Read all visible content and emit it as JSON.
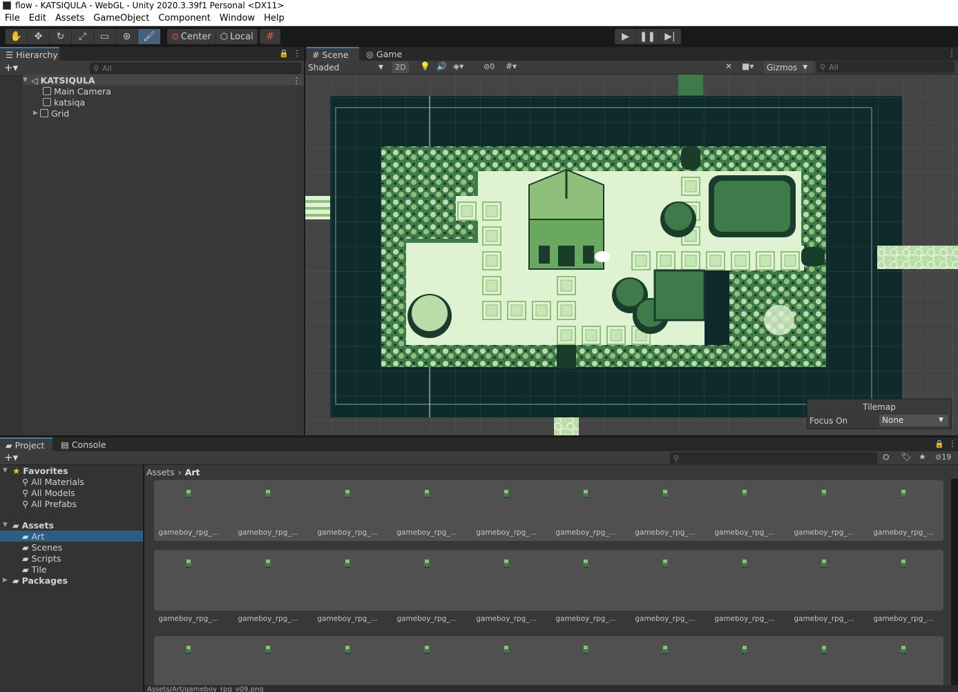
{
  "window": {
    "title": "flow - KATSIQULA - WebGL - Unity 2020.3.39f1 Personal <DX11>"
  },
  "menu": [
    "File",
    "Edit",
    "Assets",
    "GameObject",
    "Component",
    "Window",
    "Help"
  ],
  "toolbar": {
    "tools": [
      "hand-tool",
      "move-tool",
      "rotate-tool",
      "scale-tool",
      "rect-tool",
      "transform-tool",
      "custom-tool"
    ],
    "pivot_label": "Center",
    "space_label": "Local"
  },
  "hierarchy": {
    "tab_label": "Hierarchy",
    "search_placeholder": "All",
    "scene_name": "KATSIQULA",
    "items": [
      "Main Camera",
      "katsiqa",
      "Grid"
    ]
  },
  "scene": {
    "tabs": [
      "Scene",
      "Game"
    ],
    "shading": "Shaded",
    "mode_2d": "2D",
    "hidden_count": "0",
    "gizmos_label": "Gizmos",
    "search_placeholder": "All"
  },
  "tilemap_overlay": {
    "title": "Tilemap",
    "focus_label": "Focus On",
    "focus_value": "None"
  },
  "project": {
    "tabs": [
      "Project",
      "Console"
    ],
    "visible_count": "19",
    "favorites_label": "Favorites",
    "favorites": [
      "All Materials",
      "All Models",
      "All Prefabs"
    ],
    "assets_label": "Assets",
    "folders": [
      "Art",
      "Scenes",
      "Scripts",
      "Tile"
    ],
    "packages_label": "Packages",
    "breadcrumb": [
      "Assets",
      "Art"
    ],
    "asset_label": "gameboy_rpg_...",
    "status_path": "Assets/Art/gameboy_rpg_v09.png"
  },
  "colors": {
    "accent": "#3a79bb",
    "selection": "#2c5d87",
    "gb_dark": "#0f2a22",
    "gb_mid": "#3f7a4a",
    "gb_light": "#b9dca9",
    "gb_pale": "#dff2d2"
  }
}
